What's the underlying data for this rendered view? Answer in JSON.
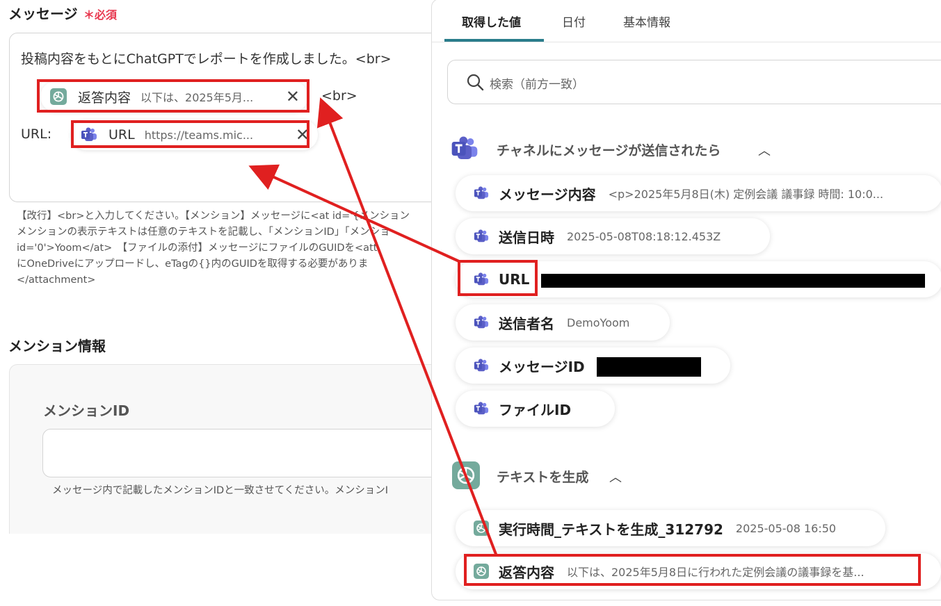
{
  "form": {
    "message_label": "メッセージ",
    "required_label": "＊必須",
    "editor_line1": "投稿内容をもとにChatGPTでレポートを作成しました。<br>",
    "tag_response": {
      "title": "返答内容",
      "value": "以下は、2025年5月..."
    },
    "br_after": "<br>",
    "url_label": "URL:",
    "tag_url": {
      "title": "URL",
      "value": "https://teams.mic..."
    },
    "help_text": "【改行】<br>と入力してください。【メンション】メッセージに<at id='{メンション\nメンションの表示テキストは任意のテキストを記載し、「メンションID」「メンショ\nid='0'>Yoom</at>　【ファイルの添付】メッセージにファイルのGUIDを<att\nにOneDriveにアップロードし、eTagの{}内のGUIDを取得する必要がありま\n</attachment>",
    "mention_section_label": "メンション情報",
    "mention_id_label": "メンションID",
    "mention_id_value": "",
    "mention_help": "メッセージ内で記載したメンションIDと一致させてください。メンションI"
  },
  "panel": {
    "tabs": [
      {
        "label": "取得した値",
        "active": true
      },
      {
        "label": "日付",
        "active": false
      },
      {
        "label": "基本情報",
        "active": false
      }
    ],
    "search_placeholder": "検索（前方一致）",
    "section_teams": {
      "title": "チャネルにメッセージが送信されたら",
      "icon": "teams-icon",
      "items": [
        {
          "title": "メッセージ内容",
          "value": "<p>2025年5月8日(木) 定例会議 議事録 時間: 10:0..."
        },
        {
          "title": "送信日時",
          "value": "2025-05-08T08:18:12.453Z"
        },
        {
          "title": "URL",
          "value": ""
        },
        {
          "title": "送信者名",
          "value": "DemoYoom"
        },
        {
          "title": "メッセージID",
          "value": ""
        },
        {
          "title": "ファイルID",
          "value": ""
        }
      ]
    },
    "section_gpt": {
      "title": "テキストを生成",
      "icon": "chatgpt-icon",
      "items": [
        {
          "title": "実行時間_テキストを生成_312792",
          "value": "2025-05-08 16:50"
        },
        {
          "title": "返答内容",
          "value": "以下は、2025年5月8日に行われた定例会議の議事録を基..."
        }
      ]
    }
  },
  "colors": {
    "accent": "#2a7d8c",
    "required": "#e8384f",
    "annotation": "#e02020",
    "teams": "#5b5fc7",
    "chatgpt": "#74aa9c"
  }
}
